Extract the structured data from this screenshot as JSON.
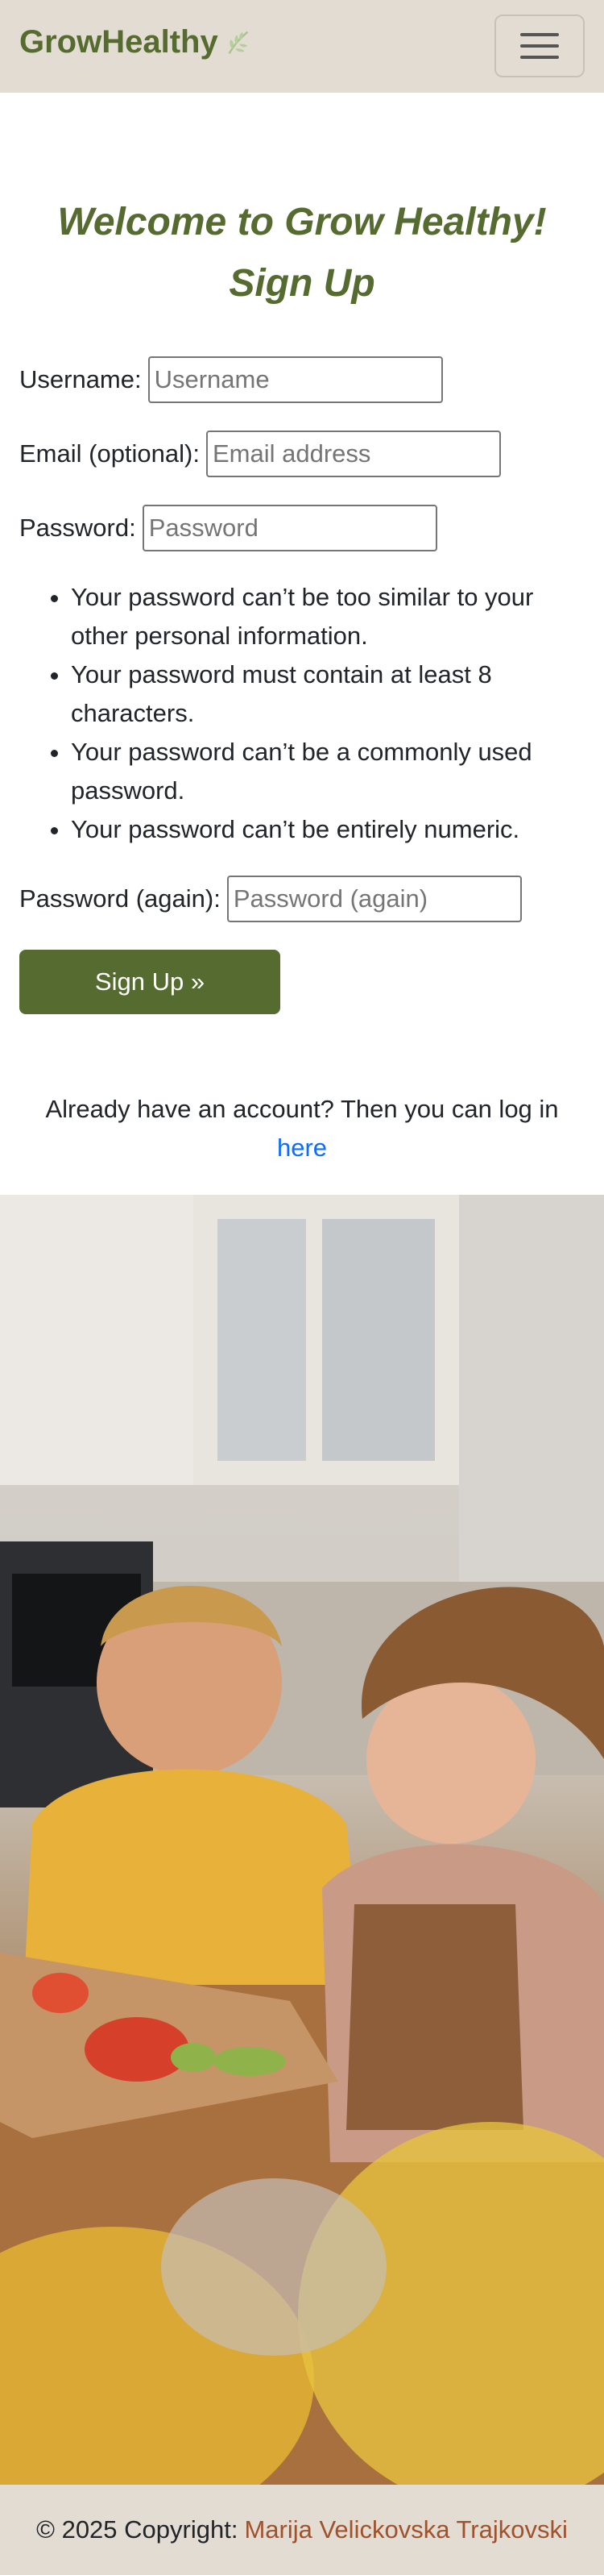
{
  "navbar": {
    "brand": "GrowHealthy",
    "brand_icon": "leaf-icon",
    "toggler_icon": "hamburger-icon"
  },
  "heading": {
    "line1": "Welcome to Grow Healthy!",
    "line2": "Sign Up"
  },
  "form": {
    "username_label": "Username:",
    "username_placeholder": "Username",
    "email_label": "Email (optional):",
    "email_placeholder": "Email address",
    "password_label": "Password:",
    "password_placeholder": "Password",
    "password_help": [
      "Your password can’t be too similar to your other personal information.",
      "Your password must contain at least 8 characters.",
      "Your password can’t be a commonly used password.",
      "Your password can’t be entirely numeric."
    ],
    "password2_label": "Password (again):",
    "password2_placeholder": "Password (again)",
    "submit_label": "Sign Up »"
  },
  "login": {
    "text": "Already have an account? Then you can log in",
    "link": "here"
  },
  "footer": {
    "copyright": "© 2025 Copyright:",
    "author": "Marija Velickovska Trajkovski"
  },
  "colors": {
    "brand": "#556b2f",
    "navbar_bg": "#e3dcd2",
    "link": "#0d6efd",
    "author": "#a0522d"
  }
}
